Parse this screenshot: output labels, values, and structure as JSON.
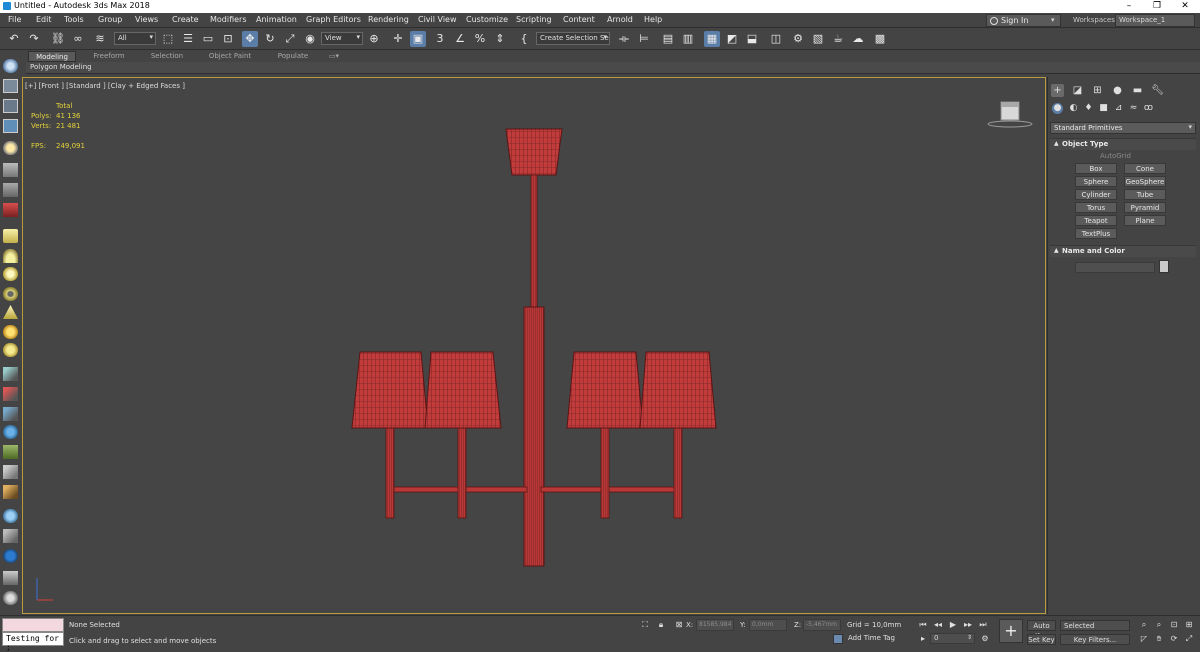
{
  "window": {
    "title": "Untitled - Autodesk 3ds Max 2018",
    "controls": [
      "–",
      "❐",
      "✕"
    ]
  },
  "menu": [
    "File",
    "Edit",
    "Tools",
    "Group",
    "Views",
    "Create",
    "Modifiers",
    "Animation",
    "Graph Editors",
    "Rendering",
    "Civil View",
    "Customize",
    "Scripting",
    "Content",
    "Arnold",
    "Help"
  ],
  "account": {
    "sign_in": "Sign In",
    "workspaces_label": "Workspaces:",
    "workspace": "Workspace_1"
  },
  "toolbar": {
    "filter": "All",
    "ref_coord": "View",
    "selection_set": "Create Selection Se"
  },
  "ribbon": {
    "tabs": [
      "Modeling",
      "Freeform",
      "Selection",
      "Object Paint",
      "Populate"
    ],
    "active_tab": "Modeling",
    "panel": "Polygon Modeling"
  },
  "viewport": {
    "label": "[+] [Front ] [Standard ] [Clay + Edged Faces ]",
    "stats": {
      "total_label": "Total",
      "polys_label": "Polys:",
      "polys": "41 136",
      "verts_label": "Verts:",
      "verts": "21 481",
      "fps_label": "FPS:",
      "fps": "249,091"
    },
    "model_color": "#c23c3c"
  },
  "command_panel": {
    "dropdown": "Standard Primitives",
    "object_type_header": "Object Type",
    "autogrid": "AutoGrid",
    "buttons": [
      "Box",
      "Cone",
      "Sphere",
      "GeoSphere",
      "Cylinder",
      "Tube",
      "Torus",
      "Pyramid",
      "Teapot",
      "Plane",
      "TextPlus"
    ],
    "name_color_header": "Name and Color"
  },
  "status": {
    "listener_text": "Testing for ;",
    "selection": "None Selected",
    "prompt": "Click and drag to select and move objects",
    "x_label": "X:",
    "x": "81585,984",
    "y_label": "Y:",
    "y": "0,0mm",
    "z_label": "Z:",
    "z": "-5,467mm",
    "grid": "Grid = 10,0mm",
    "add_time_tag": "Add Time Tag",
    "frame": "0",
    "auto_key": "Auto Key",
    "selected": "Selected",
    "set_key": "Set Key",
    "key_filters": "Key Filters..."
  },
  "colors": {
    "viewport_border": "#b79b3e",
    "active_blue": "#5b7ea9",
    "stats_yellow": "#e4d23a"
  }
}
